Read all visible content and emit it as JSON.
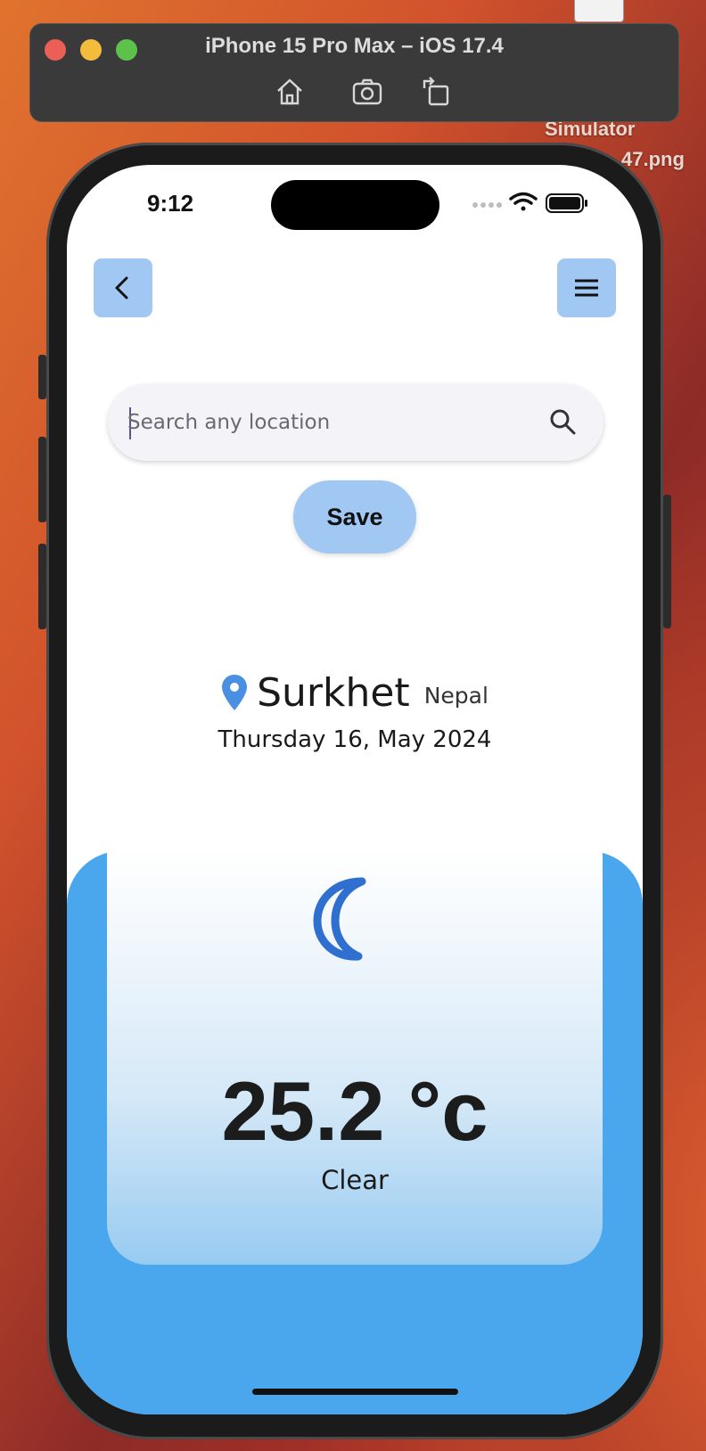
{
  "simulator": {
    "title": "iPhone 15 Pro Max – iOS 17.4",
    "tools": [
      "home-icon",
      "screenshot-icon",
      "rotate-icon"
    ],
    "desktop_label_1": "Simulator",
    "desktop_label_2": "47.png"
  },
  "status_bar": {
    "time": "9:12"
  },
  "nav": {
    "back_icon": "chevron-left-icon",
    "menu_icon": "hamburger-menu-icon"
  },
  "search": {
    "placeholder": "Search any location",
    "value": "",
    "icon": "search-icon"
  },
  "save_label": "Save",
  "location": {
    "city": "Surkhet",
    "country": "Nepal",
    "date": "Thursday 16, May 2024",
    "icon": "location-pin-icon"
  },
  "weather": {
    "icon": "moon-icon",
    "temperature": "25.2 °c",
    "condition": "Clear"
  },
  "colors": {
    "accent": "#a1c8f3",
    "panel": "#4aa7ee",
    "pin": "#4a90e2",
    "moon": "#2e6fcf"
  }
}
